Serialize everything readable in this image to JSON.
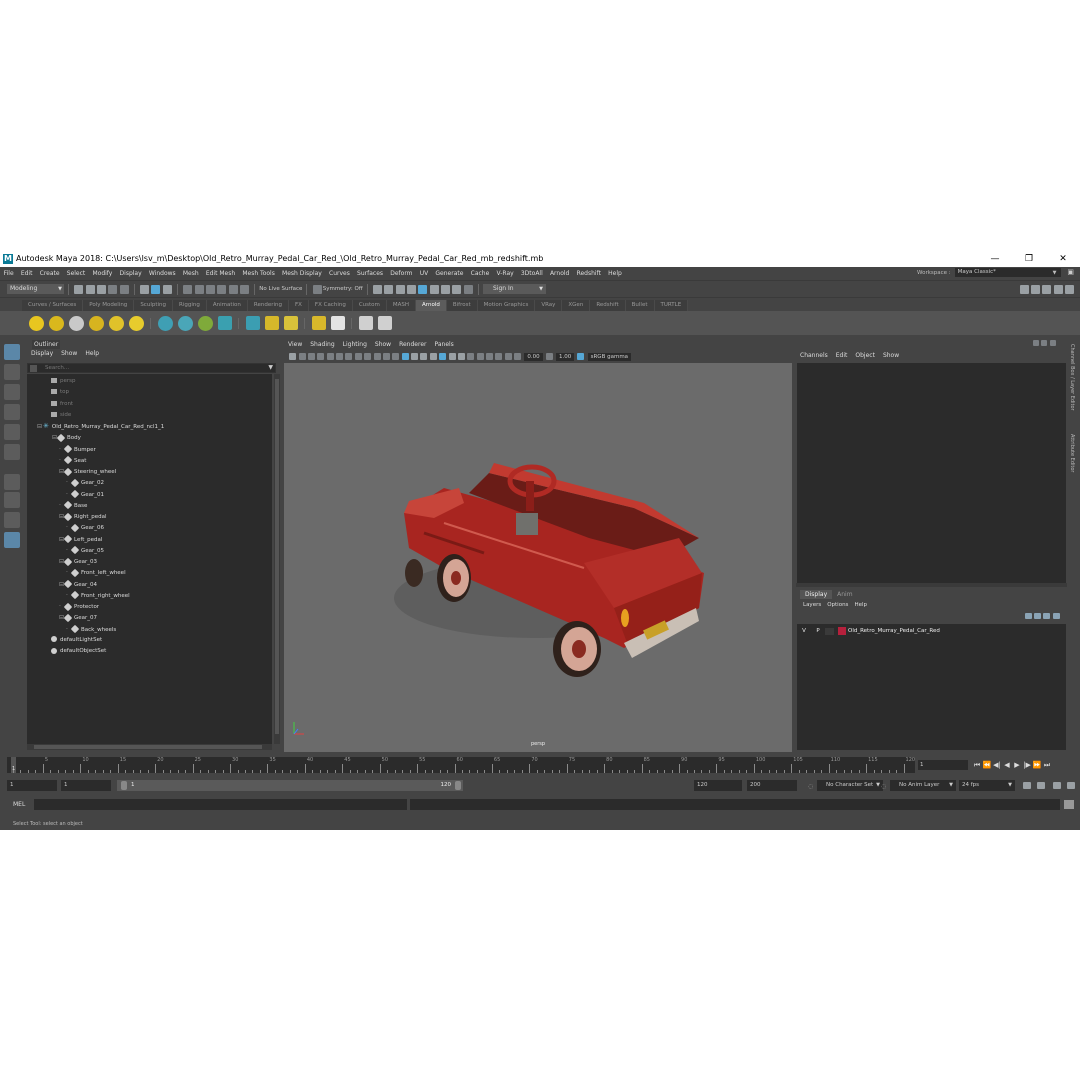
{
  "window": {
    "title": "Autodesk Maya 2018: C:\\Users\\lsv_m\\Desktop\\Old_Retro_Murray_Pedal_Car_Red_\\Old_Retro_Murray_Pedal_Car_Red_mb_redshift.mb",
    "logo": "M",
    "minimize": "—",
    "maximize": "❐",
    "close": "✕"
  },
  "menubar": {
    "items": [
      "File",
      "Edit",
      "Create",
      "Select",
      "Modify",
      "Display",
      "Windows",
      "Mesh",
      "Edit Mesh",
      "Mesh Tools",
      "Mesh Display",
      "Curves",
      "Surfaces",
      "Deform",
      "UV",
      "Generate",
      "Cache",
      "V-Ray",
      "3DtoAll",
      "Arnold",
      "Redshift",
      "Help"
    ],
    "workspace_label": "Workspace :",
    "workspace_value": "Maya Classic*"
  },
  "statusline": {
    "mode": "Modeling",
    "live_surface": "No Live Surface",
    "symmetry": "Symmetry: Off",
    "sign_in": "Sign In"
  },
  "shelf": {
    "tabs": [
      "Curves / Surfaces",
      "Poly Modeling",
      "Sculpting",
      "Rigging",
      "Animation",
      "Rendering",
      "FX",
      "FX Caching",
      "Custom",
      "MASH",
      "Arnold",
      "Bifrost",
      "Motion Graphics",
      "VRay",
      "XGen",
      "Redshift",
      "Bullet",
      "TURTLE"
    ],
    "active_tab": "Arnold"
  },
  "outliner": {
    "title": "Outliner",
    "menu": [
      "Display",
      "Show",
      "Help"
    ],
    "search_placeholder": "Search...",
    "rows": [
      {
        "label": "persp",
        "indent": 0,
        "kind": "cam"
      },
      {
        "label": "top",
        "indent": 0,
        "kind": "cam"
      },
      {
        "label": "front",
        "indent": 0,
        "kind": "cam"
      },
      {
        "label": "side",
        "indent": 0,
        "kind": "cam"
      },
      {
        "label": "Old_Retro_Murray_Pedal_Car_Red_ncl1_1",
        "indent": 0,
        "kind": "root"
      },
      {
        "label": "Body",
        "indent": 1,
        "kind": "group"
      },
      {
        "label": "Bumper",
        "indent": 2,
        "kind": "node"
      },
      {
        "label": "Seat",
        "indent": 2,
        "kind": "node"
      },
      {
        "label": "Steering_wheel",
        "indent": 2,
        "kind": "group"
      },
      {
        "label": "Gear_02",
        "indent": 3,
        "kind": "node"
      },
      {
        "label": "Gear_01",
        "indent": 3,
        "kind": "node"
      },
      {
        "label": "Base",
        "indent": 2,
        "kind": "node"
      },
      {
        "label": "Right_pedal",
        "indent": 2,
        "kind": "group"
      },
      {
        "label": "Gear_06",
        "indent": 3,
        "kind": "node"
      },
      {
        "label": "Left_pedal",
        "indent": 2,
        "kind": "group"
      },
      {
        "label": "Gear_05",
        "indent": 3,
        "kind": "node"
      },
      {
        "label": "Gear_03",
        "indent": 2,
        "kind": "group"
      },
      {
        "label": "Front_left_wheel",
        "indent": 3,
        "kind": "node"
      },
      {
        "label": "Gear_04",
        "indent": 2,
        "kind": "group"
      },
      {
        "label": "Front_right_wheel",
        "indent": 3,
        "kind": "node"
      },
      {
        "label": "Protector",
        "indent": 2,
        "kind": "node"
      },
      {
        "label": "Gear_07",
        "indent": 2,
        "kind": "group"
      },
      {
        "label": "Back_wheels",
        "indent": 3,
        "kind": "node"
      },
      {
        "label": "defaultLightSet",
        "indent": 0,
        "kind": "set"
      },
      {
        "label": "defaultObjectSet",
        "indent": 0,
        "kind": "set"
      }
    ]
  },
  "viewport": {
    "menu": [
      "View",
      "Shading",
      "Lighting",
      "Show",
      "Renderer",
      "Panels"
    ],
    "exposure": "0.00",
    "gamma": "1.00",
    "color_space": "sRGB gamma",
    "camera_label": "persp"
  },
  "channelbox": {
    "menu": [
      "Channels",
      "Edit",
      "Object",
      "Show"
    ],
    "layer_tabs": [
      "Display",
      "Anim"
    ],
    "layer_menu": [
      "Layers",
      "Options",
      "Help"
    ],
    "layer": {
      "v": "V",
      "p": "P",
      "name": "Old_Retro_Murray_Pedal_Car_Red",
      "color": "#b5203c"
    }
  },
  "sidetabs": [
    "Channel Box / Layer Editor",
    "Attribute Editor"
  ],
  "timeslider": {
    "labels": [
      "5",
      "10",
      "15",
      "20",
      "25",
      "30",
      "35",
      "40",
      "45",
      "50",
      "55",
      "60",
      "65",
      "70",
      "75",
      "80",
      "85",
      "90",
      "95",
      "100",
      "105",
      "110",
      "115",
      "120"
    ],
    "current": "1",
    "current_field": "1"
  },
  "rangeslider": {
    "start": "1",
    "start_inner": "1",
    "bar_left": "1",
    "bar_right": "120",
    "end_inner": "120",
    "end": "200",
    "character_set": "No Character Set",
    "anim_layer": "No Anim Layer",
    "fps": "24 fps"
  },
  "cmdline": {
    "label": "MEL"
  },
  "helpline": {
    "text": "Select Tool: select an object"
  },
  "colors": {
    "accent": "#5b87a8",
    "car_red": "#b8302b",
    "viewport_bg": "#6b6b6b"
  }
}
